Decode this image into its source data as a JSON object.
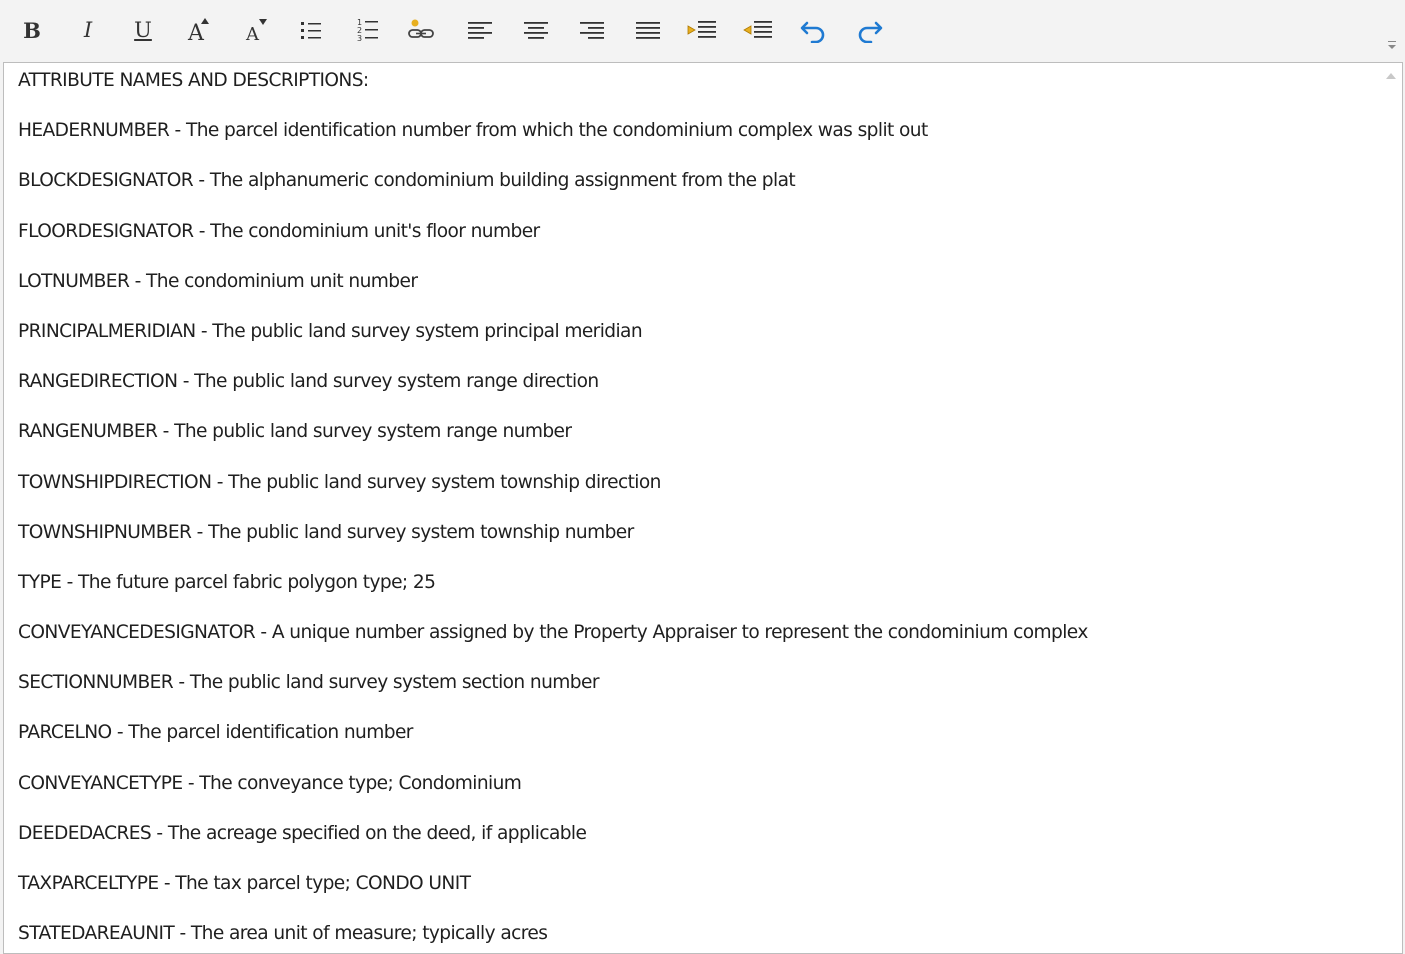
{
  "toolbar": {
    "buttons": [
      {
        "name": "bold-button",
        "icon": "bold-icon",
        "glyph": "B"
      },
      {
        "name": "italic-button",
        "icon": "italic-icon",
        "glyph": "I"
      },
      {
        "name": "underline-button",
        "icon": "underline-icon",
        "glyph": "U"
      },
      {
        "name": "increase-font-size-button",
        "icon": "font-size-increase-icon",
        "glyph": "A"
      },
      {
        "name": "decrease-font-size-button",
        "icon": "font-size-decrease-icon",
        "glyph": "A"
      },
      {
        "name": "bulleted-list-button",
        "icon": "bulleted-list-icon"
      },
      {
        "name": "numbered-list-button",
        "icon": "numbered-list-icon"
      },
      {
        "name": "insert-link-button",
        "icon": "link-icon"
      },
      {
        "name": "align-left-button",
        "icon": "align-left-icon"
      },
      {
        "name": "align-center-button",
        "icon": "align-center-icon"
      },
      {
        "name": "align-right-button",
        "icon": "align-right-icon"
      },
      {
        "name": "justify-button",
        "icon": "justify-icon"
      },
      {
        "name": "indent-button",
        "icon": "indent-icon"
      },
      {
        "name": "outdent-button",
        "icon": "outdent-icon"
      },
      {
        "name": "undo-button",
        "icon": "undo-icon"
      },
      {
        "name": "redo-button",
        "icon": "redo-icon"
      }
    ],
    "accent_color": "#1f7ad2",
    "highlight_color": "#e8b020"
  },
  "editor": {
    "lines": [
      "ATTRIBUTE NAMES AND DESCRIPTIONS:",
      "HEADERNUMBER - The parcel identification number from which the condominium complex was split out",
      "BLOCKDESIGNATOR - The alphanumeric condominium building assignment from the plat",
      "FLOORDESIGNATOR - The condominium unit's floor number",
      "LOTNUMBER - The condominium unit number",
      "PRINCIPALMERIDIAN - The public land survey system principal meridian",
      "RANGEDIRECTION - The public land survey system range direction",
      "RANGENUMBER - The public land survey system range number",
      "TOWNSHIPDIRECTION - The public land survey system township direction",
      "TOWNSHIPNUMBER - The public land survey system township number",
      "TYPE - The future parcel fabric polygon type; 25",
      "CONVEYANCEDESIGNATOR - A unique number assigned by the Property Appraiser to represent the condominium complex",
      "SECTIONNUMBER - The public land survey system section number",
      "PARCELNO - The parcel identification number",
      "CONVEYANCETYPE - The conveyance type; Condominium",
      "DEEDEDACRES - The acreage specified on the deed, if applicable",
      "TAXPARCELTYPE - The tax parcel type; CONDO UNIT",
      "STATEDAREAUNIT - The area unit of measure; typically acres"
    ]
  }
}
